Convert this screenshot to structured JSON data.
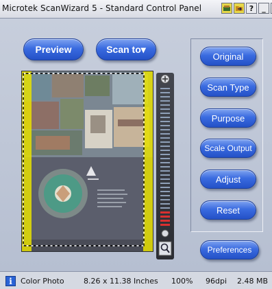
{
  "window": {
    "title": "Microtek ScanWizard 5 - Standard Control Panel"
  },
  "titlebar_buttons": {
    "help": "?",
    "minimize": "_",
    "close": "X"
  },
  "toolbar": {
    "preview_label": "Preview",
    "scan_to_label": "Scan to▾"
  },
  "side_buttons": [
    "Original",
    "Scan Type",
    "Purpose",
    "Scale Output",
    "Adjust",
    "Reset"
  ],
  "preferences_label": "Preferences",
  "status": {
    "info_icon": "i",
    "scan_type": "Color Photo",
    "size": "8.26 x 11.38 Inches",
    "scale": "100%",
    "resolution": "96dpi",
    "file_size": "2.48 MB"
  },
  "colors": {
    "accent": "#2f5fd8",
    "selection": "#e8e000"
  }
}
